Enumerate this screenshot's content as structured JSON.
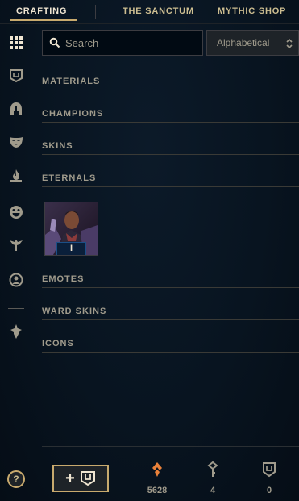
{
  "topnav": {
    "tabs": [
      {
        "label": "CRAFTING",
        "active": true
      },
      {
        "label": "THE SANCTUM",
        "active": false
      },
      {
        "label": "MYTHIC SHOP",
        "active": false
      }
    ]
  },
  "sidebar": {
    "icons": [
      {
        "name": "grid-icon",
        "active": true
      },
      {
        "name": "chest-icon"
      },
      {
        "name": "helmet-icon"
      },
      {
        "name": "mask-icon"
      },
      {
        "name": "flame-icon"
      },
      {
        "name": "smiley-icon"
      },
      {
        "name": "ward-icon"
      },
      {
        "name": "profile-icon"
      },
      {
        "name": "tft-icon"
      }
    ]
  },
  "search": {
    "placeholder": "Search"
  },
  "sort": {
    "selected": "Alphabetical"
  },
  "sections": {
    "materials": "MATERIALS",
    "champions": "CHAMPIONS",
    "skins": "SKINS",
    "eternals": "ETERNALS",
    "emotes": "EMOTES",
    "ward_skins": "WARD SKINS",
    "icons": "ICONS"
  },
  "eternals_items": [
    {
      "count": "I"
    }
  ],
  "footer": {
    "help_label": "?",
    "add_label": "+",
    "essence": "5628",
    "keys": "4",
    "chests": "0"
  },
  "colors": {
    "gold": "#c8aa6e",
    "essence_orange": "#e9813a",
    "text": "#a09b8c"
  }
}
